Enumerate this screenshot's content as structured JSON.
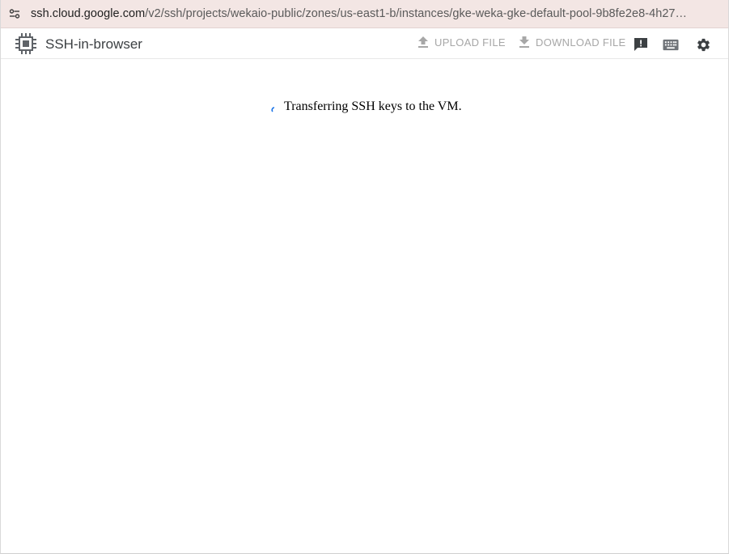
{
  "browser": {
    "url_host": "ssh.cloud.google.com",
    "url_path": "/v2/ssh/projects/wekaio-public/zones/us-east1-b/instances/gke-weka-gke-default-pool-9b8fe2e8-4h27…"
  },
  "toolbar": {
    "title": "SSH-in-browser",
    "upload_label": "UPLOAD FILE",
    "download_label": "DOWNLOAD FILE"
  },
  "content": {
    "status_text": "Transferring SSH keys to the VM."
  },
  "colors": {
    "url_bar_bg": "#f3e6e4",
    "disabled_text": "#a7a7a7",
    "icon_dark": "#3c4043",
    "spinner": "#1a73e8"
  },
  "icons": {
    "site_info": "tune-icon",
    "app_logo": "chip-icon",
    "upload": "upload-icon",
    "download": "download-icon",
    "feedback": "feedback-icon",
    "keyboard": "keyboard-icon",
    "settings": "gear-icon"
  }
}
